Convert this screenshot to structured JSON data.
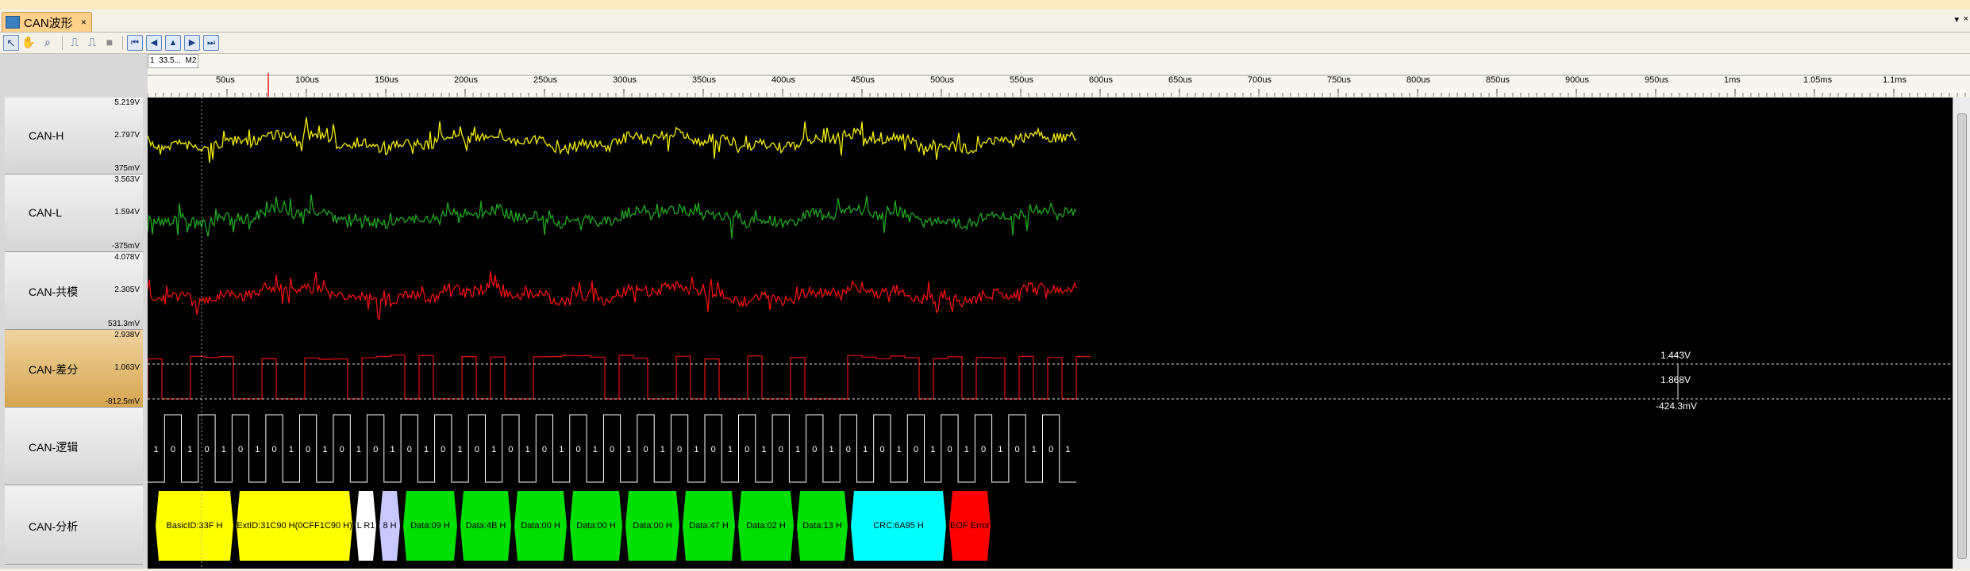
{
  "tab": {
    "title": "CAN波形",
    "close": "×"
  },
  "window_controls": {
    "dropdown": "▾",
    "close": "×"
  },
  "toolbar": {
    "icons": [
      "pointer-icon",
      "hand-icon",
      "zoom-icon",
      "pulse-rise-icon",
      "pulse-fall-icon",
      "stop-icon",
      "first-page-icon",
      "prev-page-icon",
      "center-icon",
      "next-page-icon",
      "last-page-icon"
    ]
  },
  "markers": {
    "left": "1",
    "mid": "33.5...",
    "right": "M2"
  },
  "time_axis": {
    "labels": [
      "50us",
      "100us",
      "150us",
      "200us",
      "250us",
      "300us",
      "350us",
      "400us",
      "450us",
      "500us",
      "550us",
      "600us",
      "650us",
      "700us",
      "750us",
      "800us",
      "850us",
      "900us",
      "950us",
      "1ms",
      "1.05ms",
      "1.1ms"
    ]
  },
  "channels": [
    {
      "name": "CAN-H",
      "top": "5.219V",
      "mid": "2.797V",
      "bot": "375mV",
      "color": "#f5f000"
    },
    {
      "name": "CAN-L",
      "top": "3.563V",
      "mid": "1.594V",
      "bot": "-375mV",
      "color": "#1faa1f"
    },
    {
      "name": "CAN-共模",
      "top": "4.078V",
      "mid": "2.305V",
      "bot": "531.3mV",
      "color": "#f01010"
    },
    {
      "name": "CAN-差分",
      "top": "2.938V",
      "mid": "1.063V",
      "bot": "-812.5mV",
      "color": "#e01010"
    },
    {
      "name": "CAN-逻辑",
      "top": "",
      "mid": "",
      "bot": "",
      "color": "#ffffff"
    },
    {
      "name": "CAN-分析",
      "top": "",
      "mid": "",
      "bot": "",
      "color": "#ffffff"
    }
  ],
  "cursor_readouts": {
    "upper": "1.443V",
    "delta": "1.868V",
    "lower": "-424.3mV"
  },
  "logic_bits": [
    "1",
    "0",
    "1",
    "0",
    "1",
    "0",
    "1",
    "0",
    "1",
    "0",
    "1",
    "0",
    "1",
    "0",
    "1",
    "0",
    "1",
    "0",
    "1",
    "0",
    "1",
    "0",
    "1",
    "0",
    "1",
    "0",
    "1",
    "0",
    "1",
    "0",
    "1",
    "0",
    "1",
    "0",
    "1",
    "0",
    "1",
    "0",
    "1",
    "0",
    "1",
    "0",
    "1",
    "0",
    "1",
    "0",
    "1",
    "0",
    "1",
    "0",
    "1",
    "0",
    "1",
    "0",
    "1"
  ],
  "decode_fields": [
    {
      "label": "BasicID:33F H",
      "color": "#ffff00"
    },
    {
      "label": "ExtID:31C90 H(0CFF1C90 H)",
      "color": "#ffff00"
    },
    {
      "label": "L R1 ",
      "color": "#ffffff"
    },
    {
      "label": "8 H",
      "color": "#c8c8ff"
    },
    {
      "label": "Data:09 H",
      "color": "#00e000"
    },
    {
      "label": "Data:4B H",
      "color": "#00e000"
    },
    {
      "label": "Data:00 H",
      "color": "#00e000"
    },
    {
      "label": "Data:00 H",
      "color": "#00e000"
    },
    {
      "label": "Data:00 H",
      "color": "#00e000"
    },
    {
      "label": "Data:47 H",
      "color": "#00e000"
    },
    {
      "label": "Data:02 H",
      "color": "#00e000"
    },
    {
      "label": "Data:13 H",
      "color": "#00e000"
    },
    {
      "label": "CRC:6A95 H",
      "color": "#00ffff"
    },
    {
      "label": "EOF Error",
      "color": "#ff0000"
    }
  ]
}
